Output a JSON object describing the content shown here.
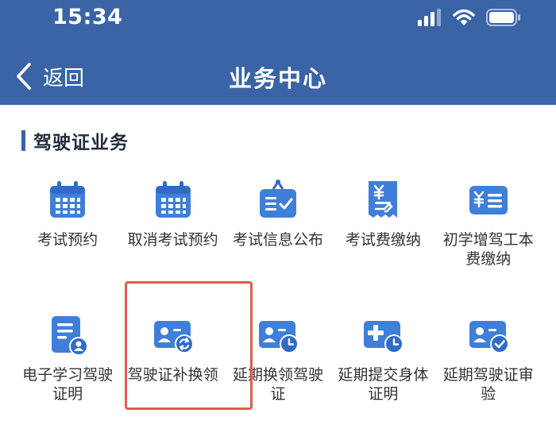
{
  "status_bar": {
    "time": "15:34"
  },
  "nav": {
    "back_label": "返回",
    "title": "业务中心"
  },
  "section": {
    "title": "驾驶证业务"
  },
  "items": [
    {
      "label": "考试预约",
      "icon": "calendar-icon"
    },
    {
      "label": "取消考试预约",
      "icon": "calendar-icon"
    },
    {
      "label": "考试信息公布",
      "icon": "notice-board-icon"
    },
    {
      "label": "考试费缴纳",
      "icon": "receipt-yuan-icon"
    },
    {
      "label": "初学增驾工本费缴纳",
      "icon": "yuan-card-icon"
    },
    {
      "label": "电子学习驾驶证明",
      "icon": "document-user-icon"
    },
    {
      "label": "驾驶证补换领",
      "icon": "license-refresh-icon"
    },
    {
      "label": "延期换领驾驶证",
      "icon": "license-clock-icon"
    },
    {
      "label": "延期提交身体证明",
      "icon": "medical-clock-icon"
    },
    {
      "label": "延期驾驶证审验",
      "icon": "license-check-icon"
    }
  ],
  "colors": {
    "header": "#3a64a6",
    "icon": "#3f7fd9",
    "highlight": "#e65a4c"
  }
}
